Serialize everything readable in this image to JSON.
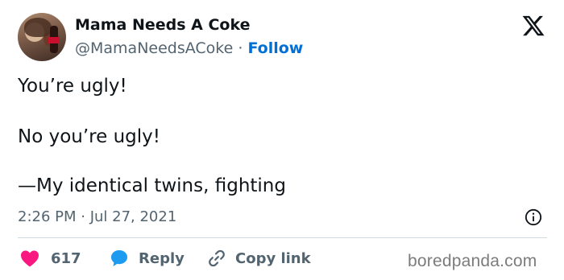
{
  "author": {
    "display_name": "Mama Needs A Coke",
    "handle": "@MamaNeedsACoke",
    "separator": " · ",
    "follow_label": "Follow"
  },
  "tweet": {
    "lines": [
      "You’re ugly!",
      "No you’re ugly!",
      "—My identical twins, fighting"
    ],
    "timestamp": "2:26 PM · Jul 27, 2021"
  },
  "actions": {
    "like_count": "617",
    "reply_label": "Reply",
    "copy_link_label": "Copy link"
  },
  "icons": {
    "like": "heart-icon",
    "reply": "speech-bubble-icon",
    "copy": "link-icon",
    "brand": "x-logo-icon",
    "info": "info-icon"
  },
  "colors": {
    "like": "#f91880",
    "reply": "#1d9bf0",
    "follow": "#006fd6",
    "muted": "#536471"
  },
  "watermark": "boredpanda.com"
}
